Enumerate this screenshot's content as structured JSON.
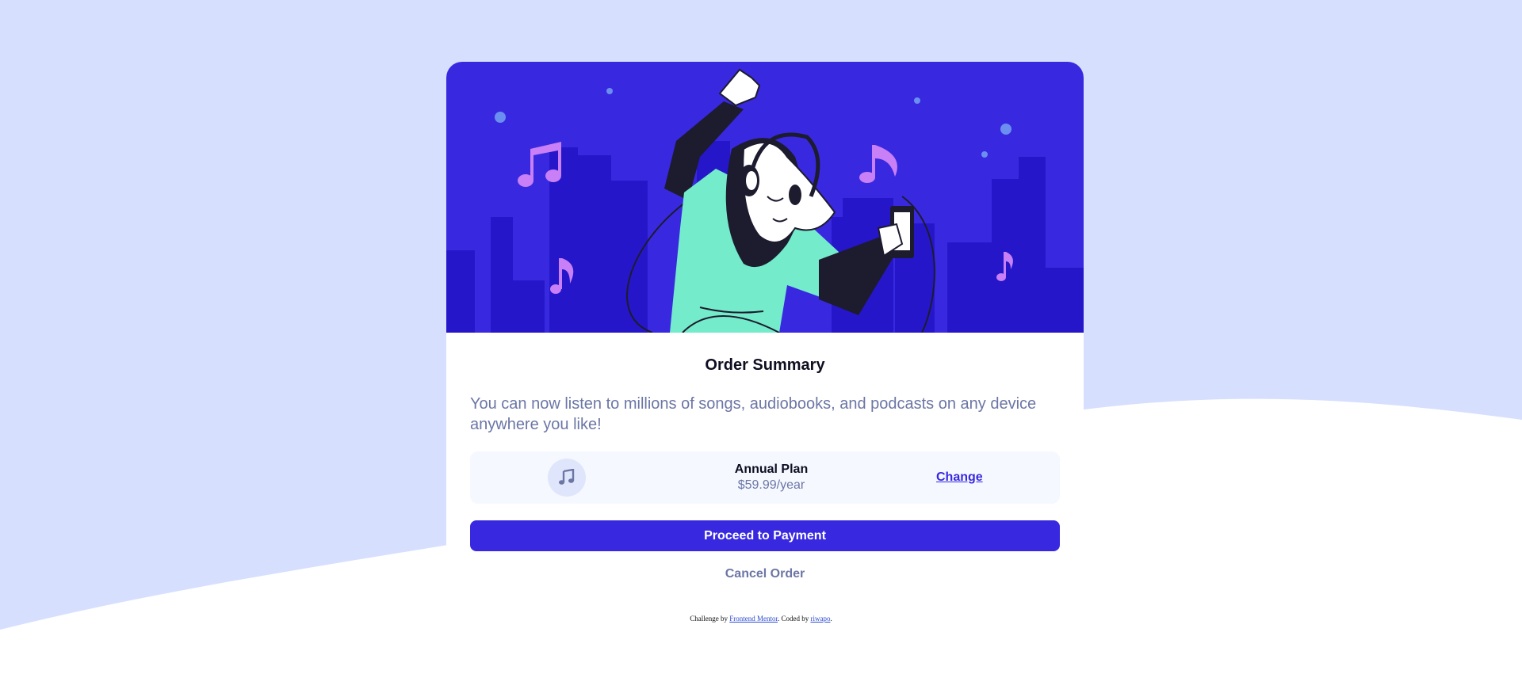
{
  "card": {
    "title": "Order Summary",
    "description": "You can now listen to millions of songs, audiobooks, and podcasts on any device anywhere you like!",
    "plan": {
      "icon": "music-note-icon",
      "name": "Annual Plan",
      "price": "$59.99/year",
      "change_label": "Change"
    },
    "proceed_label": "Proceed to Payment",
    "cancel_label": "Cancel Order"
  },
  "attribution": {
    "prefix": "Challenge by ",
    "link1": "Frontend Mentor",
    "middle": ". Coded by ",
    "link2": "riwapo",
    "suffix": "."
  },
  "colors": {
    "page_bg": "#d6e0fe",
    "accent": "#3829e0",
    "muted_text": "#6c76a5",
    "dark_text": "#0e0e21",
    "hero_skyline": "#2517c9",
    "figure_shirt": "#74ebca",
    "notes": "#c97ff5"
  }
}
